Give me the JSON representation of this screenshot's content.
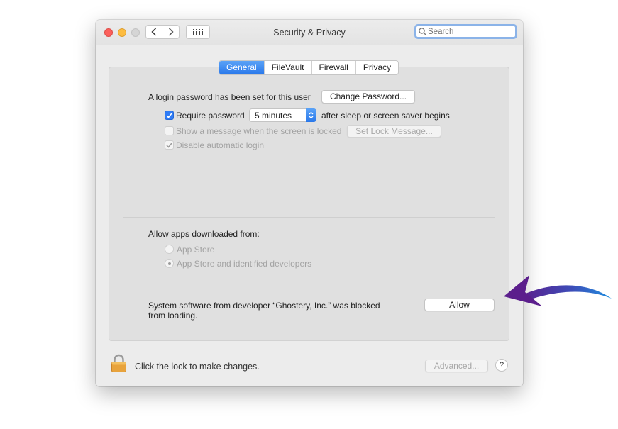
{
  "window": {
    "title": "Security & Privacy",
    "search_placeholder": "Search"
  },
  "tabs": [
    {
      "label": "General",
      "active": true
    },
    {
      "label": "FileVault",
      "active": false
    },
    {
      "label": "Firewall",
      "active": false
    },
    {
      "label": "Privacy",
      "active": false
    }
  ],
  "general": {
    "login_password_text": "A login password has been set for this user",
    "change_password_label": "Change Password...",
    "require_password_label": "Require password",
    "require_password_checked": true,
    "require_password_delay": "5 minutes",
    "after_sleep_text": "after sleep or screen saver begins",
    "show_message_label": "Show a message when the screen is locked",
    "show_message_checked": false,
    "set_lock_message_label": "Set Lock Message...",
    "disable_auto_login_label": "Disable automatic login",
    "disable_auto_login_checked": true
  },
  "allow_apps": {
    "heading": "Allow apps downloaded from:",
    "options": [
      {
        "label": "App Store",
        "selected": false
      },
      {
        "label": "App Store and identified developers",
        "selected": true
      }
    ]
  },
  "blocked": {
    "line1": "System software from developer “Ghostery, Inc.” was blocked",
    "line2": "from loading.",
    "allow_label": "Allow"
  },
  "footer": {
    "lock_text": "Click the lock to make changes.",
    "advanced_label": "Advanced...",
    "help_label": "?"
  },
  "colors": {
    "accent": "#2f7cf6",
    "arrow_start": "#5b1e8c",
    "arrow_end": "#1f8fe0"
  }
}
